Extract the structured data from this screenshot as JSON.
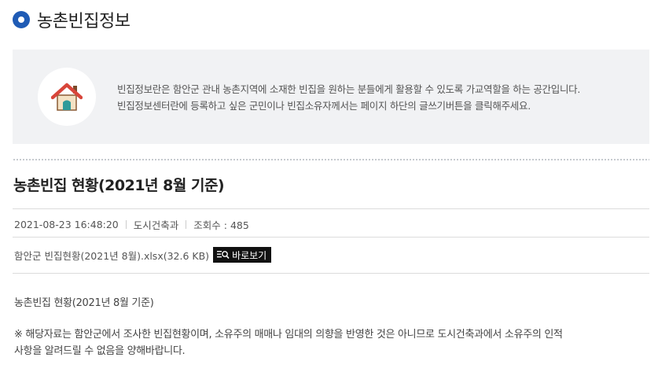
{
  "header": {
    "title": "농촌빈집정보",
    "icon": "circle-bullet-icon",
    "accent_color": "#1f5bb5"
  },
  "info": {
    "icon": "house-icon",
    "line1": "빈집정보란은 함안군 관내 농촌지역에 소재한 빈집을 원하는 분들에게 활용할 수 있도록 가교역할을 하는 공간입니다.",
    "line2": "빈집정보센터란에 등록하고 싶은 군민이나 빈집소유자께서는 페이지 하단의 글쓰기버튼을 클릭해주세요."
  },
  "post": {
    "title": "농촌빈집 현황(2021년 8월 기준)",
    "date": "2021-08-23 16:48:20",
    "department": "도시건축과",
    "views": "조회수 : 485",
    "attachment": {
      "filename": "함안군 빈집현황(2021년 8월).xlsx(32.6 KB)",
      "view_label": "바로보기",
      "view_icon": "preview-icon"
    },
    "body_heading": "농촌빈집 현황(2021년 8월 기준)",
    "body_note_line1": "※ 해당자료는 함안군에서 조사한 빈집현황이며, 소유주의 매매나 임대의 의향을 반영한 것은 아니므로 도시건축과에서 소유주의 인적",
    "body_note_line2": "사항을 알려드릴 수 없음을 양해바랍니다."
  }
}
